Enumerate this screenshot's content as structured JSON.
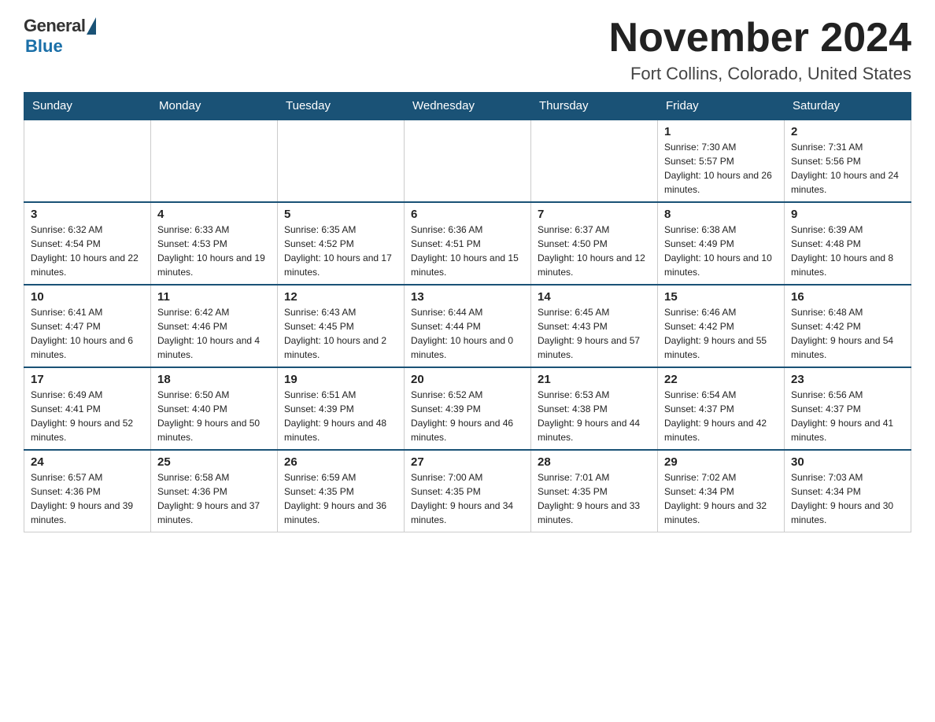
{
  "logo": {
    "general": "General",
    "blue": "Blue"
  },
  "title": "November 2024",
  "location": "Fort Collins, Colorado, United States",
  "weekdays": [
    "Sunday",
    "Monday",
    "Tuesday",
    "Wednesday",
    "Thursday",
    "Friday",
    "Saturday"
  ],
  "weeks": [
    [
      {
        "day": "",
        "info": ""
      },
      {
        "day": "",
        "info": ""
      },
      {
        "day": "",
        "info": ""
      },
      {
        "day": "",
        "info": ""
      },
      {
        "day": "",
        "info": ""
      },
      {
        "day": "1",
        "info": "Sunrise: 7:30 AM\nSunset: 5:57 PM\nDaylight: 10 hours and 26 minutes."
      },
      {
        "day": "2",
        "info": "Sunrise: 7:31 AM\nSunset: 5:56 PM\nDaylight: 10 hours and 24 minutes."
      }
    ],
    [
      {
        "day": "3",
        "info": "Sunrise: 6:32 AM\nSunset: 4:54 PM\nDaylight: 10 hours and 22 minutes."
      },
      {
        "day": "4",
        "info": "Sunrise: 6:33 AM\nSunset: 4:53 PM\nDaylight: 10 hours and 19 minutes."
      },
      {
        "day": "5",
        "info": "Sunrise: 6:35 AM\nSunset: 4:52 PM\nDaylight: 10 hours and 17 minutes."
      },
      {
        "day": "6",
        "info": "Sunrise: 6:36 AM\nSunset: 4:51 PM\nDaylight: 10 hours and 15 minutes."
      },
      {
        "day": "7",
        "info": "Sunrise: 6:37 AM\nSunset: 4:50 PM\nDaylight: 10 hours and 12 minutes."
      },
      {
        "day": "8",
        "info": "Sunrise: 6:38 AM\nSunset: 4:49 PM\nDaylight: 10 hours and 10 minutes."
      },
      {
        "day": "9",
        "info": "Sunrise: 6:39 AM\nSunset: 4:48 PM\nDaylight: 10 hours and 8 minutes."
      }
    ],
    [
      {
        "day": "10",
        "info": "Sunrise: 6:41 AM\nSunset: 4:47 PM\nDaylight: 10 hours and 6 minutes."
      },
      {
        "day": "11",
        "info": "Sunrise: 6:42 AM\nSunset: 4:46 PM\nDaylight: 10 hours and 4 minutes."
      },
      {
        "day": "12",
        "info": "Sunrise: 6:43 AM\nSunset: 4:45 PM\nDaylight: 10 hours and 2 minutes."
      },
      {
        "day": "13",
        "info": "Sunrise: 6:44 AM\nSunset: 4:44 PM\nDaylight: 10 hours and 0 minutes."
      },
      {
        "day": "14",
        "info": "Sunrise: 6:45 AM\nSunset: 4:43 PM\nDaylight: 9 hours and 57 minutes."
      },
      {
        "day": "15",
        "info": "Sunrise: 6:46 AM\nSunset: 4:42 PM\nDaylight: 9 hours and 55 minutes."
      },
      {
        "day": "16",
        "info": "Sunrise: 6:48 AM\nSunset: 4:42 PM\nDaylight: 9 hours and 54 minutes."
      }
    ],
    [
      {
        "day": "17",
        "info": "Sunrise: 6:49 AM\nSunset: 4:41 PM\nDaylight: 9 hours and 52 minutes."
      },
      {
        "day": "18",
        "info": "Sunrise: 6:50 AM\nSunset: 4:40 PM\nDaylight: 9 hours and 50 minutes."
      },
      {
        "day": "19",
        "info": "Sunrise: 6:51 AM\nSunset: 4:39 PM\nDaylight: 9 hours and 48 minutes."
      },
      {
        "day": "20",
        "info": "Sunrise: 6:52 AM\nSunset: 4:39 PM\nDaylight: 9 hours and 46 minutes."
      },
      {
        "day": "21",
        "info": "Sunrise: 6:53 AM\nSunset: 4:38 PM\nDaylight: 9 hours and 44 minutes."
      },
      {
        "day": "22",
        "info": "Sunrise: 6:54 AM\nSunset: 4:37 PM\nDaylight: 9 hours and 42 minutes."
      },
      {
        "day": "23",
        "info": "Sunrise: 6:56 AM\nSunset: 4:37 PM\nDaylight: 9 hours and 41 minutes."
      }
    ],
    [
      {
        "day": "24",
        "info": "Sunrise: 6:57 AM\nSunset: 4:36 PM\nDaylight: 9 hours and 39 minutes."
      },
      {
        "day": "25",
        "info": "Sunrise: 6:58 AM\nSunset: 4:36 PM\nDaylight: 9 hours and 37 minutes."
      },
      {
        "day": "26",
        "info": "Sunrise: 6:59 AM\nSunset: 4:35 PM\nDaylight: 9 hours and 36 minutes."
      },
      {
        "day": "27",
        "info": "Sunrise: 7:00 AM\nSunset: 4:35 PM\nDaylight: 9 hours and 34 minutes."
      },
      {
        "day": "28",
        "info": "Sunrise: 7:01 AM\nSunset: 4:35 PM\nDaylight: 9 hours and 33 minutes."
      },
      {
        "day": "29",
        "info": "Sunrise: 7:02 AM\nSunset: 4:34 PM\nDaylight: 9 hours and 32 minutes."
      },
      {
        "day": "30",
        "info": "Sunrise: 7:03 AM\nSunset: 4:34 PM\nDaylight: 9 hours and 30 minutes."
      }
    ]
  ]
}
